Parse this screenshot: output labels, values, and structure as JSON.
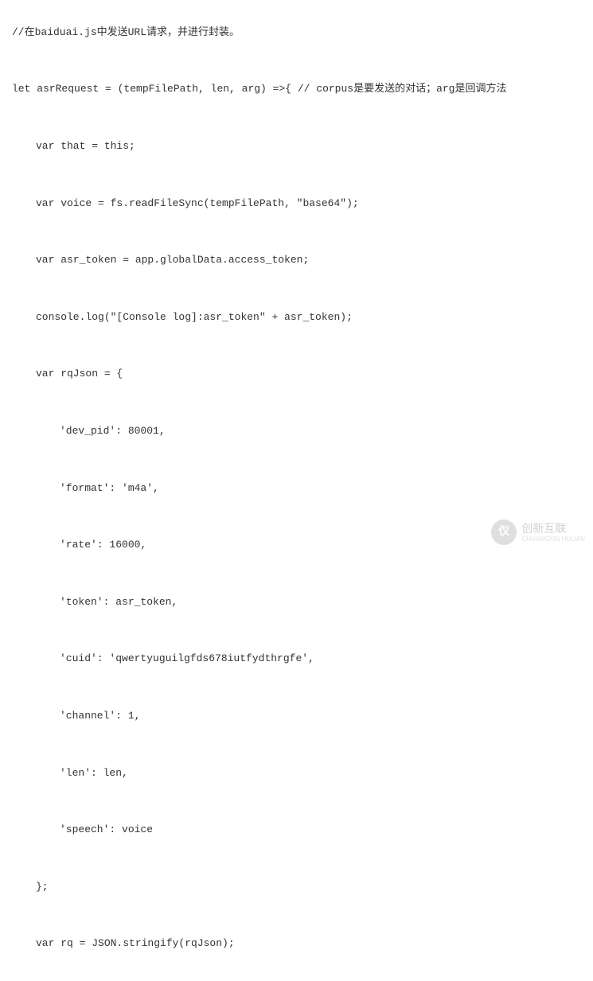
{
  "code": {
    "line1": "//在baiduai.js中发送URL请求，并进行封装。",
    "line2": "let asrRequest = (tempFilePath, len, arg) =>{ // corpus是要发送的对话；arg是回调方法",
    "line3": "var that = this;",
    "line4": "var voice = fs.readFileSync(tempFilePath, \"base64\");",
    "line5": "var asr_token = app.globalData.access_token;",
    "line6": "console.log(\"[Console log]:asr_token\" + asr_token);",
    "line7": "var rqJson = {",
    "line8": "'dev_pid': 80001,",
    "line9": "'format': 'm4a',",
    "line10": "'rate': 16000,",
    "line11": "'token': asr_token,",
    "line12": "'cuid': 'qwertyuguilgfds678iutfydthrgfe',",
    "line13": "'channel': 1,",
    "line14": "'len': len,",
    "line15": "'speech': voice",
    "line16": "};",
    "line17": "var rq = JSON.stringify(rqJson);"
  },
  "watermark": {
    "logo": "仪",
    "main": "创新互联",
    "sub": "CHUANGXIN HULIAN"
  }
}
